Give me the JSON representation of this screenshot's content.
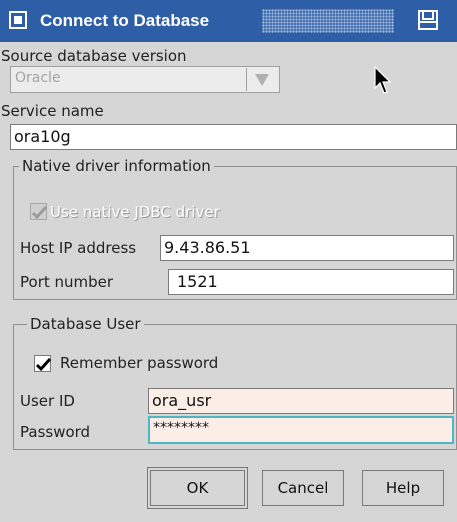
{
  "window": {
    "title": "Connect to Database"
  },
  "source": {
    "label": "Source database version",
    "value": "Oracle"
  },
  "service": {
    "label": "Service name",
    "value": "ora10g"
  },
  "native": {
    "group_title": "Native driver information",
    "use_native_label": "Use native JDBC driver",
    "use_native_checked": true,
    "host_label": "Host IP address",
    "host_value": "9.43.86.51",
    "port_label": "Port number",
    "port_value": "1521"
  },
  "user": {
    "group_title": "Database  User",
    "remember_label": "Remember password",
    "remember_checked": true,
    "userid_label": "User ID",
    "userid_value": "ora_usr",
    "password_label": "Password",
    "password_value": "********"
  },
  "buttons": {
    "ok": "OK",
    "cancel": "Cancel",
    "help": "Help"
  }
}
